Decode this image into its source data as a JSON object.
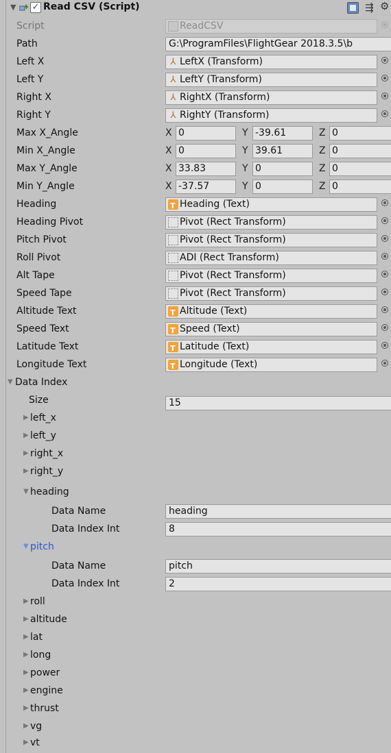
{
  "component": {
    "title": "Read CSV (Script)",
    "enabled": true,
    "fold_icon": "foldout-open-icon",
    "component_icon": "script-component-icon",
    "help_icon": "help-book-icon",
    "layout_icon": "layout-icon",
    "settings_icon": "gear-icon"
  },
  "fields": {
    "script": {
      "label": "Script",
      "value": "ReadCSV"
    },
    "path": {
      "label": "Path",
      "value": "G:\\ProgramFiles\\FlightGear 2018.3.5\\b"
    },
    "left_x": {
      "label": "Left X",
      "value": "LeftX (Transform)"
    },
    "left_y": {
      "label": "Left Y",
      "value": "LeftY (Transform)"
    },
    "right_x": {
      "label": "Right X",
      "value": "RightX (Transform)"
    },
    "right_y": {
      "label": "Right Y",
      "value": "RightY (Transform)"
    },
    "max_x_angle": {
      "label": "Max X_Angle",
      "x": "0",
      "y": "-39.61",
      "z": "0"
    },
    "min_x_angle": {
      "label": "Min X_Angle",
      "x": "0",
      "y": "39.61",
      "z": "0"
    },
    "max_y_angle": {
      "label": "Max Y_Angle",
      "x": "33.83",
      "y": "0",
      "z": "0"
    },
    "min_y_angle": {
      "label": "Min Y_Angle",
      "x": "-37.57",
      "y": "0",
      "z": "0"
    },
    "heading": {
      "label": "Heading",
      "value": "Heading (Text)"
    },
    "heading_pivot": {
      "label": "Heading Pivot",
      "value": "Pivot (Rect Transform)"
    },
    "pitch_pivot": {
      "label": "Pitch Pivot",
      "value": "Pivot (Rect Transform)"
    },
    "roll_pivot": {
      "label": "Roll Pivot",
      "value": "ADI (Rect Transform)"
    },
    "alt_tape": {
      "label": "Alt Tape",
      "value": "Pivot (Rect Transform)"
    },
    "speed_tape": {
      "label": "Speed Tape",
      "value": "Pivot (Rect Transform)"
    },
    "altitude_text": {
      "label": "Altitude Text",
      "value": "Altitude (Text)"
    },
    "speed_text": {
      "label": "Speed Text",
      "value": "Speed (Text)"
    },
    "latitude_text": {
      "label": "Latitude Text",
      "value": "Latitude (Text)"
    },
    "longitude_text": {
      "label": "Longitude Text",
      "value": "Longitude (Text)"
    }
  },
  "axis_labels": {
    "x": "X",
    "y": "Y",
    "z": "Z"
  },
  "data_index": {
    "label": "Data Index",
    "size_label": "Size",
    "size_value": "15",
    "sub_labels": {
      "data_name": "Data Name",
      "data_index_int": "Data Index Int"
    },
    "elements": [
      {
        "name": "left_x",
        "expanded": false
      },
      {
        "name": "left_y",
        "expanded": false
      },
      {
        "name": "right_x",
        "expanded": false
      },
      {
        "name": "right_y",
        "expanded": false
      },
      {
        "name": "heading",
        "expanded": true,
        "data_name": "heading",
        "data_index_int": "8"
      },
      {
        "name": "pitch",
        "expanded": true,
        "selected": true,
        "data_name": "pitch",
        "data_index_int": "2"
      },
      {
        "name": "roll",
        "expanded": false
      },
      {
        "name": "altitude",
        "expanded": false
      },
      {
        "name": "lat",
        "expanded": false
      },
      {
        "name": "long",
        "expanded": false
      },
      {
        "name": "power",
        "expanded": false
      },
      {
        "name": "engine",
        "expanded": false
      },
      {
        "name": "thrust",
        "expanded": false
      },
      {
        "name": "vg",
        "expanded": false
      },
      {
        "name": "vt",
        "expanded": false
      }
    ]
  },
  "colors": {
    "panel_bg": "#c2c2c2",
    "field_bg": "#e4e4e4",
    "selected_text": "#2a55d6",
    "text_icon": "#f2a33a",
    "transform_icon": "#b36b2b"
  }
}
